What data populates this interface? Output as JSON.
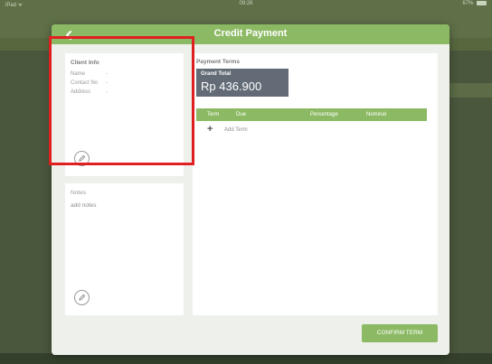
{
  "status_bar": {
    "left": "iPad ᯤ",
    "time": "09:26",
    "battery": "67%"
  },
  "modal": {
    "title": "Credit Payment",
    "back_icon": "chevron-left-icon"
  },
  "client_info": {
    "label": "Client Info",
    "rows": [
      {
        "label": "Name",
        "value": "-"
      },
      {
        "label": "Contact No",
        "value": "-"
      },
      {
        "label": "Address",
        "value": "-"
      }
    ],
    "edit_icon": "pencil-icon"
  },
  "notes": {
    "label": "Notes",
    "text": "add notes",
    "edit_icon": "pencil-icon"
  },
  "payment_terms": {
    "label": "Payment Terms",
    "grand_total_label": "Grand Total",
    "grand_total_value": "Rp 436.900",
    "columns": [
      "Term",
      "Due",
      "Percentage",
      "Nominal"
    ],
    "add_term_label": "Add Term",
    "add_icon": "plus-icon"
  },
  "confirm_button": "CONFIRM TERM",
  "colors": {
    "accent": "#8cba64",
    "grand_total_bg": "#626b76",
    "highlight": "#e02020"
  }
}
